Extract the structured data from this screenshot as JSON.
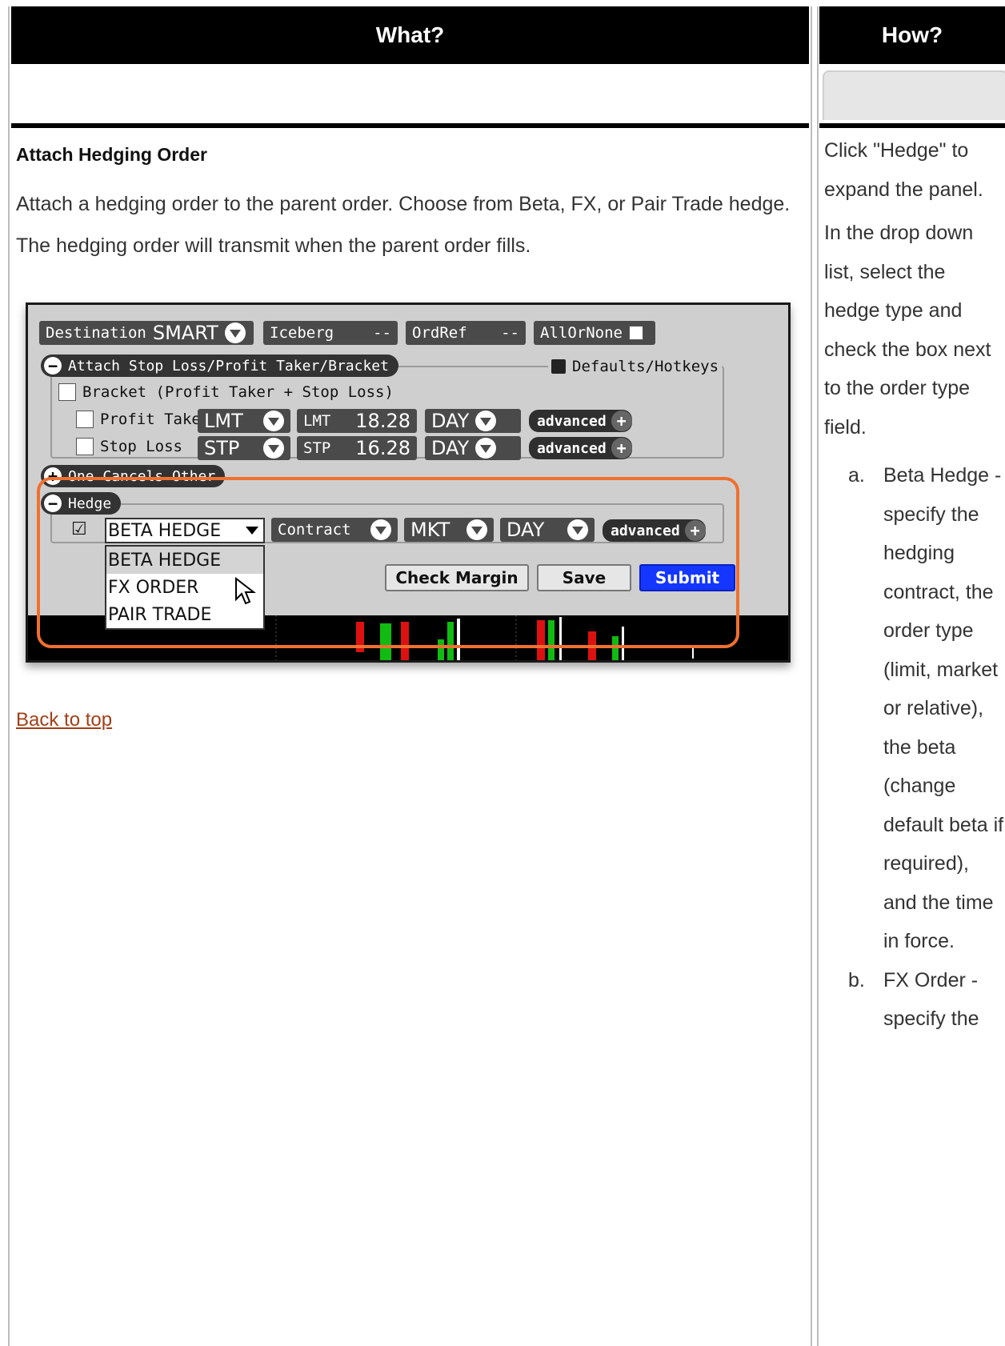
{
  "header": {
    "what": "What?",
    "how": "How?"
  },
  "what": {
    "title": "Attach Hedging Order",
    "description": "Attach a hedging order to the parent order. Choose from Beta, FX, or Pair Trade hedge. The hedging order will transmit when the parent order fills.",
    "back_link": "Back to top"
  },
  "screenshot": {
    "destination_label": "Destination",
    "destination_value": "SMART",
    "iceberg_label": "Iceberg",
    "iceberg_value": "--",
    "ordref_label": "OrdRef",
    "ordref_value": "--",
    "allornone_label": "AllOrNone",
    "attach_tab": "Attach Stop Loss/Profit Taker/Bracket",
    "defaults_label": "Defaults/Hotkeys",
    "bracket_label": "Bracket (Profit Taker + Stop Loss)",
    "profit_taker_label": "Profit Taker",
    "profit_type": "LMT",
    "profit_price_label": "LMT",
    "profit_price": "18.28",
    "profit_tif": "DAY",
    "stop_loss_label": "Stop Loss",
    "stop_type": "STP",
    "stop_price_label": "STP",
    "stop_price": "16.28",
    "stop_tif": "DAY",
    "advanced_label": "advanced",
    "oco_tab": "One Cancels Other",
    "hedge_tab": "Hedge",
    "hedge_selected": "BETA HEDGE",
    "hedge_options": [
      "BETA HEDGE",
      "FX ORDER",
      "PAIR TRADE"
    ],
    "contract_label": "Contract",
    "hedge_type": "MKT",
    "hedge_tif": "DAY",
    "check_margin": "Check Margin",
    "save": "Save",
    "submit": "Submit"
  },
  "how": {
    "p1": "Click \"Hedge\" to expand the panel.",
    "p2": "In the drop down list, select the hedge type and check the box next to the order type field.",
    "items": [
      {
        "marker": "a.",
        "text": "Beta Hedge - specify the hedging contract, the order type (limit, market or relative), the beta (change default beta if required), and the time in force."
      },
      {
        "marker": "b.",
        "text": "FX Order - specify the"
      }
    ]
  }
}
